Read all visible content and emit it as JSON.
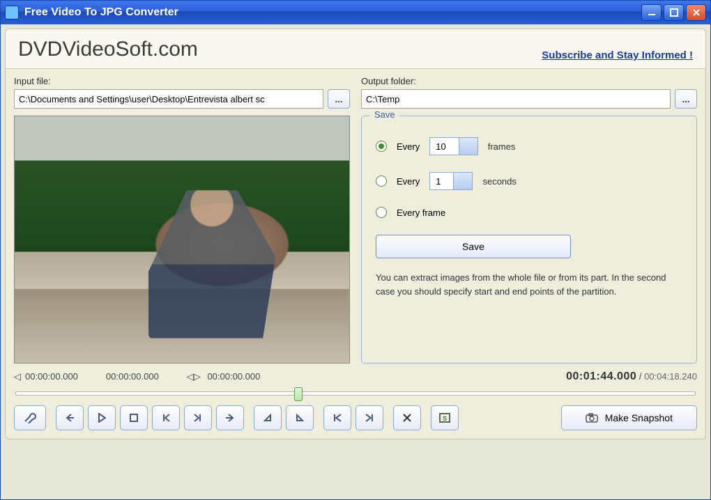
{
  "window": {
    "title": "Free Video To JPG Converter"
  },
  "header": {
    "brand": "DVDVideoSoft.com",
    "subscribe": "Subscribe and Stay Informed !"
  },
  "input": {
    "label": "Input file:",
    "value": "C:\\Documents and Settings\\user\\Desktop\\Entrevista albert sc",
    "browse": "..."
  },
  "output": {
    "label": "Output folder:",
    "value": "C:\\Temp",
    "browse": "..."
  },
  "save": {
    "legend": "Save",
    "every_frames_label": "Every",
    "every_frames_value": "10",
    "every_frames_unit": "frames",
    "every_seconds_label": "Every",
    "every_seconds_value": "1",
    "every_seconds_unit": "seconds",
    "every_frame_label": "Every frame",
    "button": "Save",
    "hint": "You can extract images from the whole file or from its part. In the second case you should specify start and end points of the partition."
  },
  "timeline": {
    "start_marker": "00:00:00.000",
    "mid_marker": "00:00:00.000",
    "range_marker": "00:00:00.000",
    "current": "00:01:44.000",
    "sep": " / ",
    "total": "00:04:18.240"
  },
  "snapshot": {
    "label": "Make Snapshot"
  }
}
